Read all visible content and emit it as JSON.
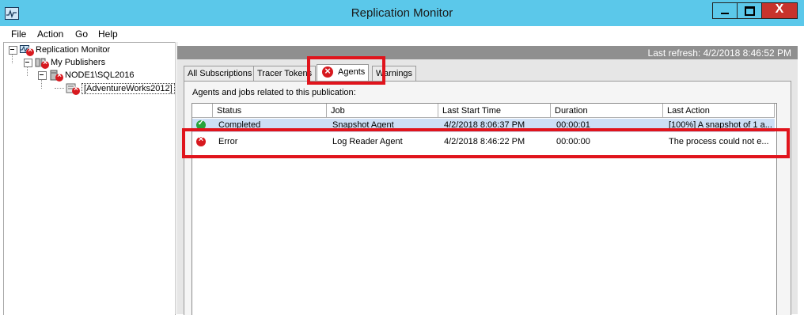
{
  "window": {
    "title": "Replication Monitor",
    "controls": {
      "minimize": "minimize",
      "maximize": "maximize",
      "close": "X"
    }
  },
  "menu": [
    "File",
    "Action",
    "Go",
    "Help"
  ],
  "tree": {
    "root": "Replication Monitor",
    "publishers": "My Publishers",
    "server": "NODE1\\SQL2016",
    "publication": "[AdventureWorks2012]"
  },
  "header": {
    "last_refresh": "Last refresh: 4/2/2018 8:46:52 PM"
  },
  "tabs": [
    {
      "label": "All Subscriptions"
    },
    {
      "label": "Tracer Tokens"
    },
    {
      "label": "Agents",
      "icon": "error-icon",
      "active": true
    },
    {
      "label": "Warnings"
    }
  ],
  "panel": {
    "caption": "Agents and jobs related to this publication:"
  },
  "grid": {
    "columns": [
      "Status",
      "Job",
      "Last Start Time",
      "Duration",
      "Last Action"
    ],
    "rows": [
      {
        "status_icon": "success-icon",
        "status": "Completed",
        "job": "Snapshot Agent",
        "last_start": "4/2/2018 8:06:37 PM",
        "duration": "00:00:01",
        "last_action": "[100%] A snapshot of 1 a..."
      },
      {
        "status_icon": "error-icon",
        "status": "Error",
        "job": "Log Reader Agent",
        "last_start": "4/2/2018 8:46:22 PM",
        "duration": "00:00:00",
        "last_action": "The process could not e..."
      }
    ]
  },
  "colors": {
    "titlebar": "#5bc8ea",
    "header_bar": "#8f8f8f",
    "highlight": "#e0141c",
    "error": "#d7191f",
    "success": "#27a33a",
    "selected_row": "#cddff5"
  }
}
